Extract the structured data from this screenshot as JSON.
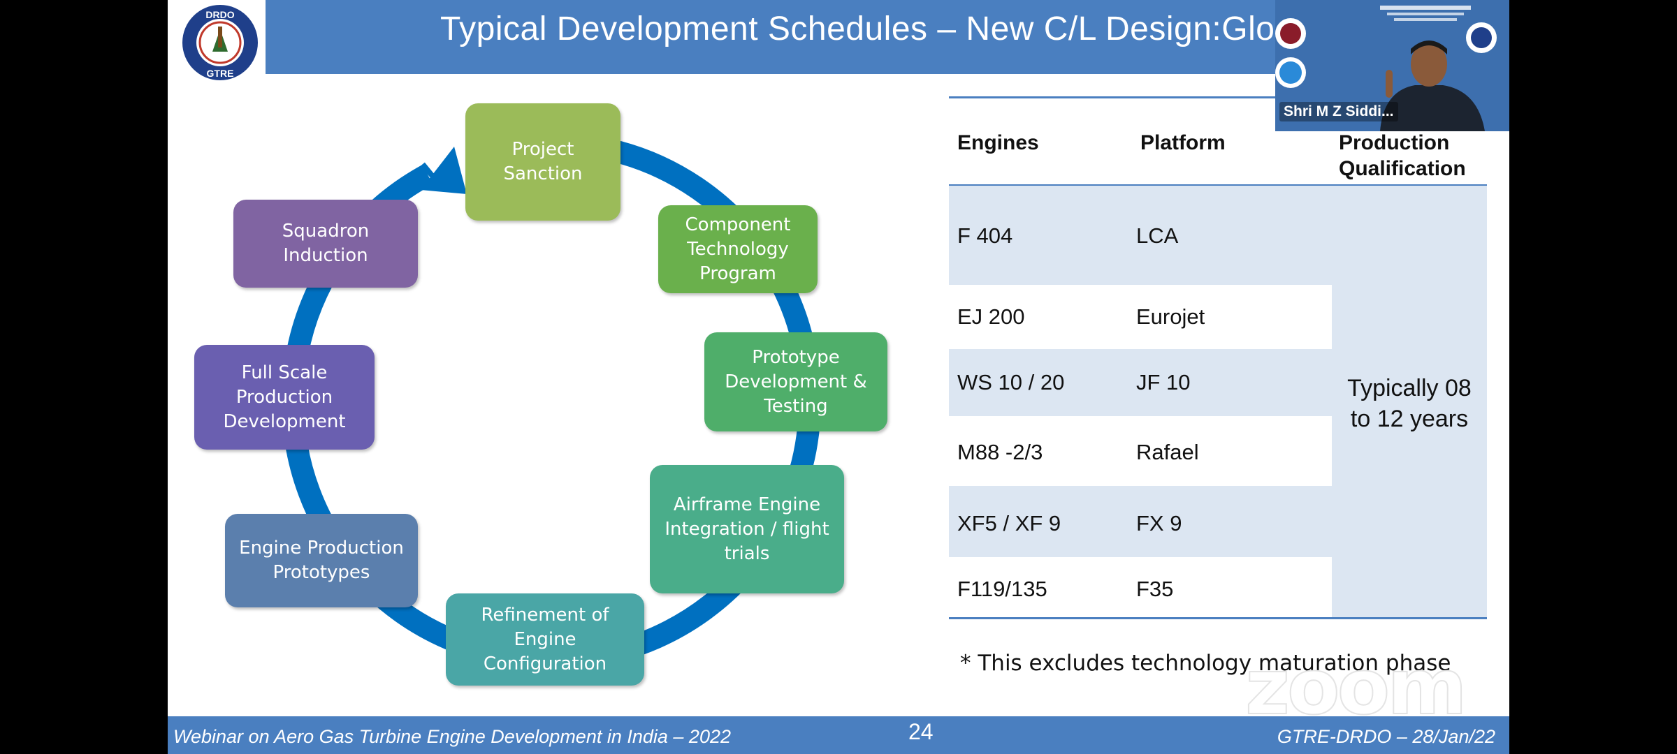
{
  "slide": {
    "title": "Typical Development Schedules  – New C/L Design:Global Be",
    "page_number": "24",
    "footer_left": "Webinar on Aero Gas Turbine Engine Development  in India  – 2022",
    "footer_right": "GTRE-DRDO – 28/Jan/22"
  },
  "logo": {
    "top_text": "DRDO",
    "bottom_text": "GTRE"
  },
  "cycle": {
    "steps": [
      {
        "label": "Project\nSanction",
        "color": "#9bbb59"
      },
      {
        "label": "Component\nTechnology\nProgram",
        "color": "#6ab04c"
      },
      {
        "label": "Prototype\nDevelopment &\nTesting",
        "color": "#4fae6a"
      },
      {
        "label": "Airframe Engine\nIntegration / flight\ntrials",
        "color": "#4aad8a"
      },
      {
        "label": "Refinement of\nEngine\nConfiguration",
        "color": "#4aa6a6"
      },
      {
        "label": "Engine Production\nPrototypes",
        "color": "#5b7fad"
      },
      {
        "label": "Full Scale\nProduction\nDevelopment",
        "color": "#6a5fb0"
      },
      {
        "label": "Squadron\nInduction",
        "color": "#8064a2"
      }
    ],
    "ring_color": "#0070c0"
  },
  "table": {
    "headers": {
      "engines": "Engines",
      "platform": "Platform",
      "production": "Production\nQualification"
    },
    "rows": [
      {
        "engine": "F 404",
        "platform": "LCA"
      },
      {
        "engine": "EJ 200",
        "platform": "Eurojet"
      },
      {
        "engine": "WS 10 / 20",
        "platform": "JF 10"
      },
      {
        "engine": "M88 -2/3",
        "platform": "Rafael"
      },
      {
        "engine": "XF5 / XF 9",
        "platform": "FX 9"
      },
      {
        "engine": "F119/135",
        "platform": "F35"
      }
    ],
    "production_value": "Typically 08\nto 12 years"
  },
  "footnote": "* This excludes technology maturation phase",
  "watermark": "zoom",
  "video": {
    "participant_name": "Shri M Z Siddi..."
  },
  "colors": {
    "header": "#4a7fc0",
    "shading": "#dce6f2"
  }
}
